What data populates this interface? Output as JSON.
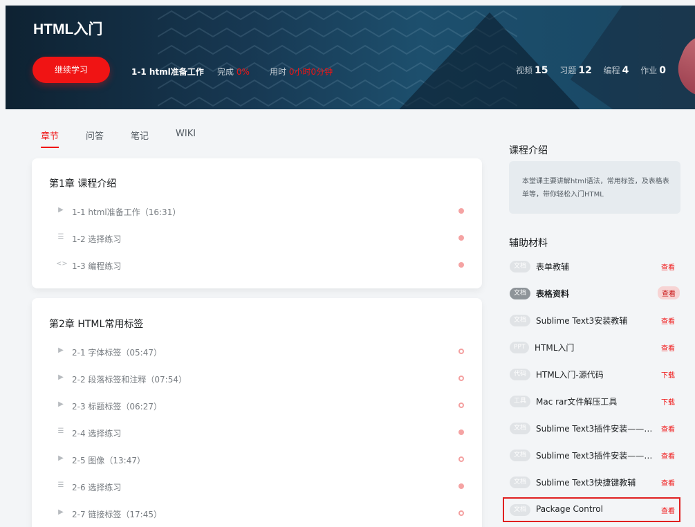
{
  "header": {
    "course_title": "HTML入门",
    "continue_label": "继续学习",
    "current_lesson": "1-1 html准备工作",
    "done_label": "完成",
    "done_value": "0%",
    "time_label": "用时",
    "time_value": "0小时0分钟",
    "stats": [
      {
        "label": "视频",
        "value": "15"
      },
      {
        "label": "习题",
        "value": "12"
      },
      {
        "label": "编程",
        "value": "4"
      },
      {
        "label": "作业",
        "value": "0"
      }
    ]
  },
  "tabs": [
    "章节",
    "问答",
    "笔记",
    "WIKI"
  ],
  "chapters": [
    {
      "title": "第1章 课程介绍",
      "lessons": [
        {
          "icon": "▶",
          "title": "1-1 html准备工作（16:31）"
        },
        {
          "icon": "☰",
          "title": "1-2 选择练习"
        },
        {
          "icon": "<>",
          "title": "1-3 编程练习"
        }
      ]
    },
    {
      "title": "第2章 HTML常用标签",
      "lessons": [
        {
          "icon": "▶",
          "title": "2-1 字体标签（05:47）"
        },
        {
          "icon": "▶",
          "title": "2-2 段落标签和注释（07:54）"
        },
        {
          "icon": "▶",
          "title": "2-3 标题标签（06:27）"
        },
        {
          "icon": "☰",
          "title": "2-4 选择练习"
        },
        {
          "icon": "▶",
          "title": "2-5 图像（13:47）"
        },
        {
          "icon": "☰",
          "title": "2-6 选择练习"
        },
        {
          "icon": "▶",
          "title": "2-7 链接标签（17:45）"
        }
      ]
    }
  ],
  "sidebar": {
    "intro_heading": "课程介绍",
    "intro_text": "本堂课主要讲解html语法，常用标签，及表格表单等，带你轻松入门HTML",
    "materials_heading": "辅助材料",
    "materials": [
      {
        "tag": "文档",
        "title": "表单教辅",
        "action": "查看"
      },
      {
        "tag": "文档",
        "title": "表格资料",
        "action": "查看"
      },
      {
        "tag": "文档",
        "title": "Sublime Text3安装教辅",
        "action": "查看"
      },
      {
        "tag": "PPT",
        "title": "HTML入门",
        "action": "查看"
      },
      {
        "tag": "代码",
        "title": "HTML入门-源代码",
        "action": "下载"
      },
      {
        "tag": "工具",
        "title": "Mac rar文件解压工具",
        "action": "下载"
      },
      {
        "tag": "文档",
        "title": "Sublime Text3插件安装——手...",
        "action": "查看"
      },
      {
        "tag": "文档",
        "title": "Sublime Text3插件安装——在...",
        "action": "查看"
      },
      {
        "tag": "文档",
        "title": "Sublime Text3快捷键教辅",
        "action": "查看"
      },
      {
        "tag": "文档",
        "title": "Package Control",
        "action": "查看"
      }
    ]
  }
}
